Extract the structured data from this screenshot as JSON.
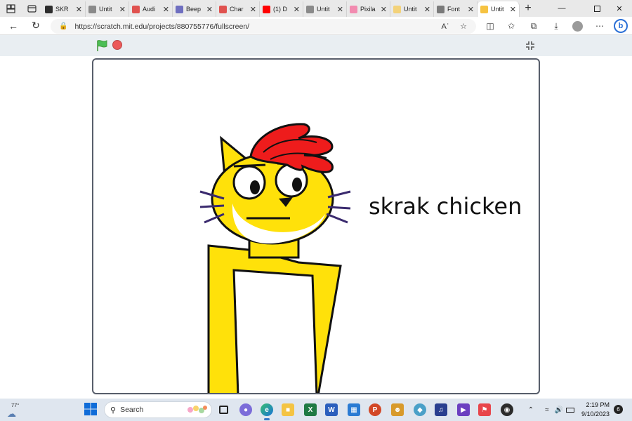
{
  "browser": {
    "tabs": [
      {
        "title": "SKR",
        "favicon_color": "#2d2d2d"
      },
      {
        "title": "Untit",
        "favicon_color": "#8a8a8a"
      },
      {
        "title": "Audi",
        "favicon_color": "#e0524f"
      },
      {
        "title": "Beep",
        "favicon_color": "#6f6fc0"
      },
      {
        "title": "Char",
        "favicon_color": "#e0524f"
      },
      {
        "title": "(1) D",
        "favicon_color": "#ff0000"
      },
      {
        "title": "Untit",
        "favicon_color": "#8a8a8a"
      },
      {
        "title": "Pixila",
        "favicon_color": "#f28bb0"
      },
      {
        "title": "Untit",
        "favicon_color": "#f3d27a"
      },
      {
        "title": "Font",
        "favicon_color": "#7a7a7a"
      },
      {
        "title": "Untit",
        "favicon_color": "#f6c342",
        "active": true
      }
    ],
    "url": "https://scratch.mit.edu/projects/880755776/fullscreen/"
  },
  "scratch": {
    "say_text": "skrak chicken",
    "flag_color": "#4cbf56",
    "stop_color": "#ec5959"
  },
  "taskbar": {
    "weather_temp": "77°",
    "search_label": "Search",
    "time": "2:19 PM",
    "date": "9/10/2023",
    "notification_count": "6"
  }
}
